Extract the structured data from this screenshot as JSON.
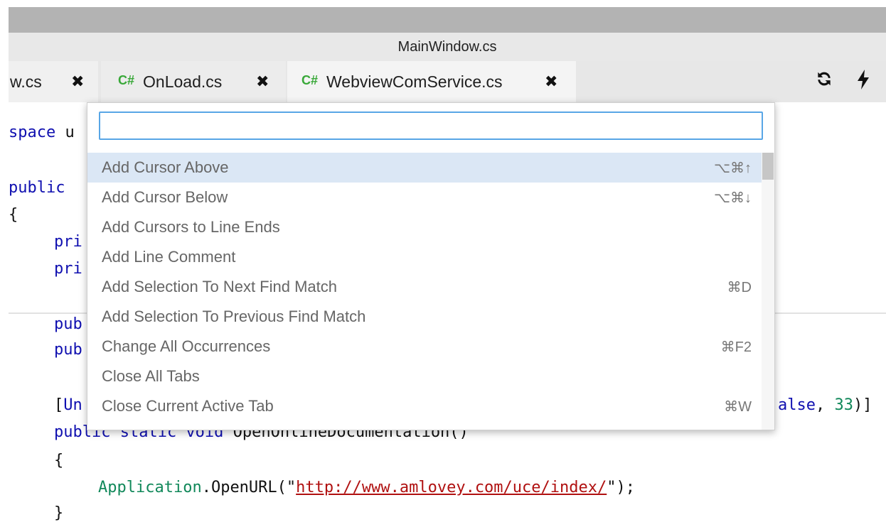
{
  "window": {
    "title": "MainWindow.cs"
  },
  "tabs": [
    {
      "label": "w.cs",
      "icon": "",
      "close": "✖"
    },
    {
      "label": "OnLoad.cs",
      "icon": "C#",
      "close": "✖"
    },
    {
      "label": "WebviewComService.cs",
      "icon": "C#",
      "close": "✖"
    }
  ],
  "toolbar": {
    "refresh_icon": "refresh-icon",
    "run_icon": "lightning-bolt-icon"
  },
  "palette": {
    "search_value": "",
    "items": [
      {
        "label": "Add Cursor Above",
        "shortcut": "⌥⌘↑"
      },
      {
        "label": "Add Cursor Below",
        "shortcut": "⌥⌘↓"
      },
      {
        "label": "Add Cursors to Line Ends",
        "shortcut": ""
      },
      {
        "label": "Add Line Comment",
        "shortcut": ""
      },
      {
        "label": "Add Selection To Next Find Match",
        "shortcut": "⌘D"
      },
      {
        "label": "Add Selection To Previous Find Match",
        "shortcut": ""
      },
      {
        "label": "Change All Occurrences",
        "shortcut": "⌘F2"
      },
      {
        "label": "Close All Tabs",
        "shortcut": ""
      },
      {
        "label": "Close Current Active Tab",
        "shortcut": "⌘W"
      }
    ]
  },
  "code": {
    "l1_kw": "space",
    "l1_rest": " u",
    "l2_kw": "public",
    "l3": "{",
    "l4_kw": "pri",
    "l5_kw": "pri",
    "l6_kw": "pub",
    "l7_kw": "pub",
    "l8_a": "[",
    "l8_kw": "Un",
    "l8_b_kw": "alse",
    "l8_c": ", ",
    "l8_num": "33",
    "l8_d": ")]",
    "l9_kw": "public static void",
    "l9_rest": " OpenOnlineDocumentation()",
    "l10": "{",
    "l11_a": "Application",
    "l11_b": ".OpenURL(\"",
    "l11_url": "http://www.amlovey.com/uce/index/",
    "l11_c": "\");",
    "l12": "}"
  },
  "colors": {
    "accent": "#58a6e6",
    "selected_row": "#dbe7f5",
    "csharp_icon": "#38a838",
    "keyword": "#1010b0",
    "string": "#b01010"
  }
}
